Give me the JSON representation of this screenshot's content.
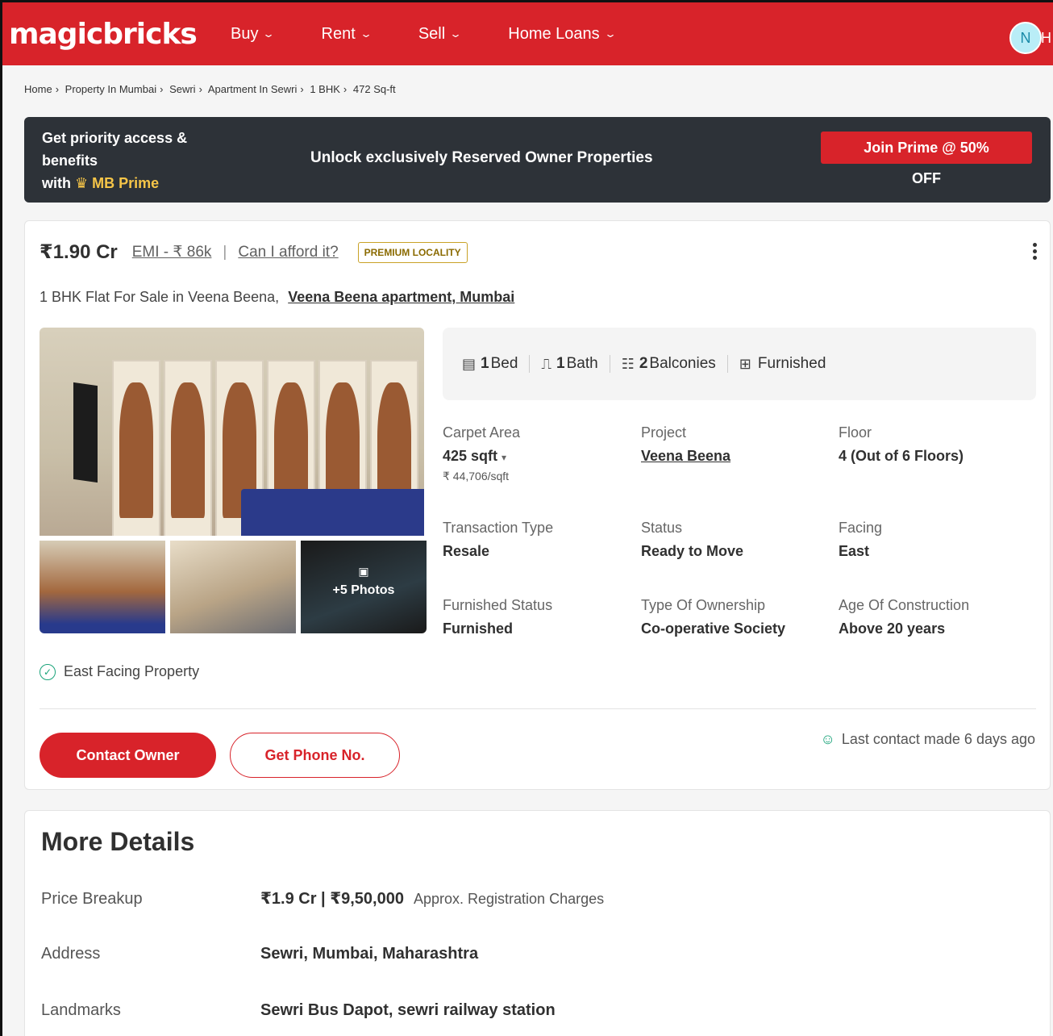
{
  "header": {
    "logo": "magicbricks",
    "nav": [
      {
        "label": "Buy"
      },
      {
        "label": "Rent"
      },
      {
        "label": "Sell"
      },
      {
        "label": "Home Loans"
      }
    ],
    "avatar_initial": "N",
    "avatar_tail": "H"
  },
  "breadcrumb": [
    "Home",
    "Property In Mumbai",
    "Sewri",
    "Apartment In Sewri",
    "1 BHK",
    "472 Sq-ft"
  ],
  "prime": {
    "line1": "Get priority access &",
    "line2": "benefits",
    "line3_prefix": "with",
    "brand": "MB Prime",
    "middle": "Unlock exclusively Reserved Owner Properties",
    "button": "Join Prime @ 50%",
    "button_sub": "OFF"
  },
  "listing": {
    "price": "₹1.90 Cr",
    "emi": "EMI - ₹ 86k",
    "afford": "Can I afford it?",
    "badge": "PREMIUM LOCALITY",
    "title": "1 BHK Flat For Sale in Veena Beena,",
    "project_link": "Veena Beena apartment, Mumbai",
    "more_photos": "+5 Photos",
    "amenities": [
      {
        "icon": "bed-icon",
        "num": "1",
        "label": "Bed"
      },
      {
        "icon": "bath-icon",
        "num": "1",
        "label": "Bath"
      },
      {
        "icon": "balcony-icon",
        "num": "2",
        "label": "Balconies"
      },
      {
        "icon": "furnished-icon",
        "num": "",
        "label": "Furnished"
      }
    ],
    "details": {
      "carpet_label": "Carpet Area",
      "carpet_value": "425 sqft",
      "carpet_sub": "₹ 44,706/sqft",
      "project_label": "Project",
      "project_value": "Veena Beena",
      "floor_label": "Floor",
      "floor_value": "4 (Out of 6 Floors)",
      "transaction_label": "Transaction Type",
      "transaction_value": "Resale",
      "status_label": "Status",
      "status_value": "Ready to Move",
      "facing_label": "Facing",
      "facing_value": "East",
      "furnished_label": "Furnished Status",
      "furnished_value": "Furnished",
      "ownership_label": "Type Of Ownership",
      "ownership_value": "Co-operative Society",
      "age_label": "Age Of Construction",
      "age_value": "Above 20 years"
    },
    "east_facing": "East Facing Property",
    "contact_owner": "Contact Owner",
    "get_phone": "Get Phone No.",
    "last_contact": "Last contact made 6 days ago"
  },
  "more_details": {
    "title": "More Details",
    "price_label": "Price Breakup",
    "price_value": "₹1.9 Cr | ₹9,50,000",
    "price_note": "Approx. Registration Charges",
    "address_label": "Address",
    "address_value": "Sewri, Mumbai, Maharashtra",
    "landmarks_label": "Landmarks",
    "landmarks_value": "Sewri Bus Dapot, sewri railway station"
  },
  "colors": {
    "brand_red": "#d8232a",
    "banner_dark": "#2d3238",
    "prime_gold": "#f6c548",
    "success_green": "#1aa37a"
  }
}
